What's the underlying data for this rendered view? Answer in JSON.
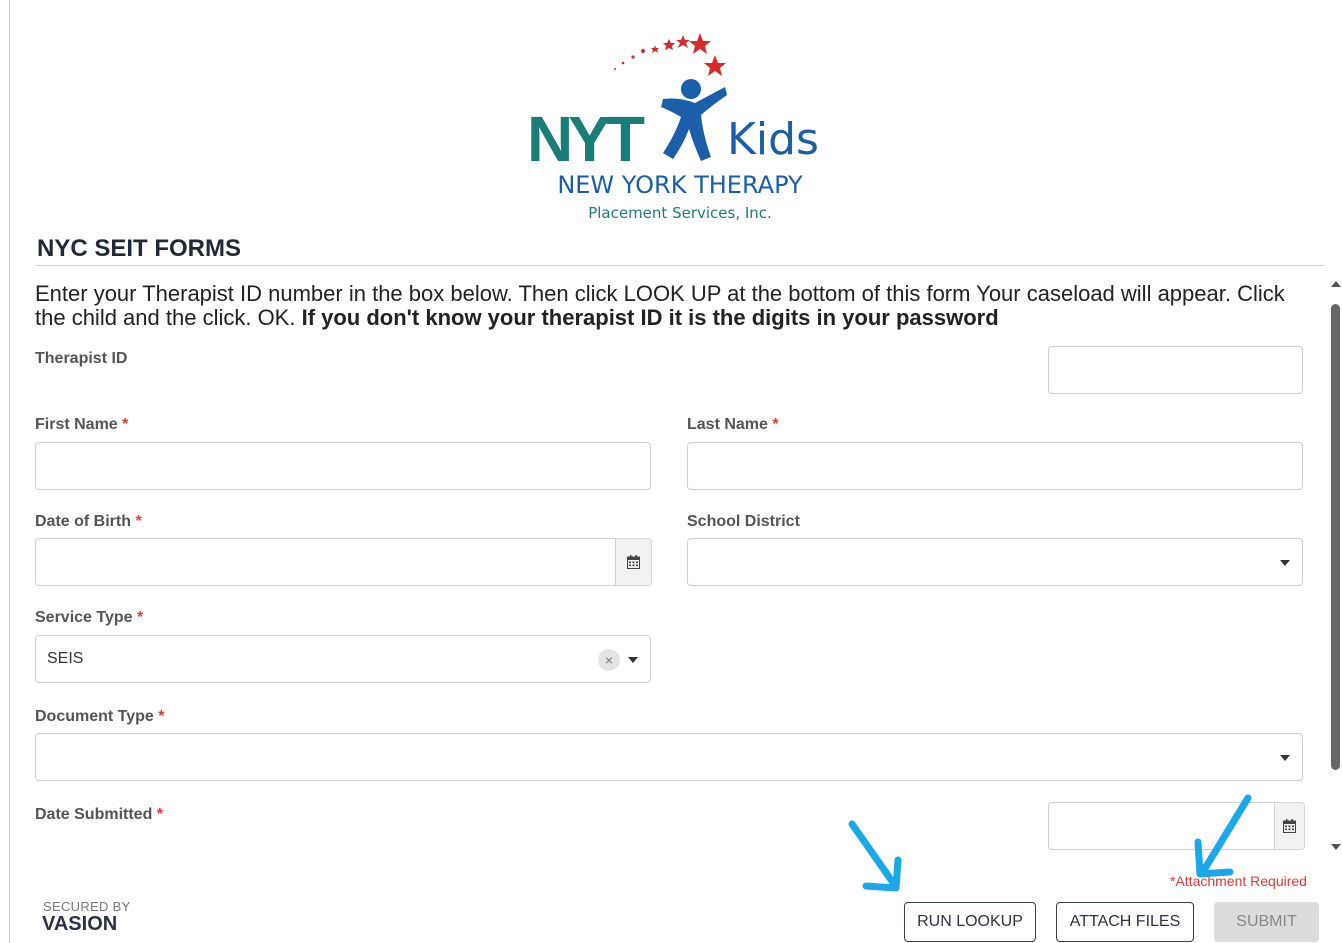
{
  "logo": {
    "brand_short": "NYT",
    "brand_kids": "Kids",
    "brand_name": "NEW YORK THERAPY",
    "brand_sub": "Placement Services, Inc."
  },
  "form": {
    "title": "NYC SEIT FORMS",
    "intro_plain": "Enter your Therapist ID number in the box below. Then click LOOK UP at the bottom of this form Your caseload will appear. Click the child and the click. OK. ",
    "intro_bold": "If you don't know your therapist ID it is the digits in your password",
    "required_mark": "*",
    "fields": {
      "therapist_id": {
        "label": "Therapist ID",
        "value": ""
      },
      "first_name": {
        "label": "First Name",
        "value": ""
      },
      "last_name": {
        "label": "Last Name",
        "value": ""
      },
      "date_of_birth": {
        "label": "Date of Birth",
        "value": ""
      },
      "school_district": {
        "label": "School District",
        "value": ""
      },
      "service_type": {
        "label": "Service Type",
        "value": "SEIS",
        "clear": "×"
      },
      "document_type": {
        "label": "Document Type",
        "value": ""
      },
      "date_submitted": {
        "label": "Date Submitted",
        "value": ""
      }
    },
    "attachment_note": "*Attachment Required",
    "buttons": {
      "run_lookup": "RUN LOOKUP",
      "attach_files": "ATTACH FILES",
      "submit": "SUBMIT"
    }
  },
  "footer": {
    "secured_by": "SECURED BY",
    "vendor": "VASION"
  },
  "colors": {
    "accent_teal": "#1b7d78",
    "accent_blue": "#1a5fa8",
    "required_red": "#e53935",
    "annotation_arrow": "#1aa8e8",
    "button_text": "#2d3148"
  },
  "icons": [
    "calendar-icon",
    "chevron-down-icon",
    "clear-icon",
    "star-icon",
    "child-figure-icon",
    "annotation-arrow-icon"
  ]
}
